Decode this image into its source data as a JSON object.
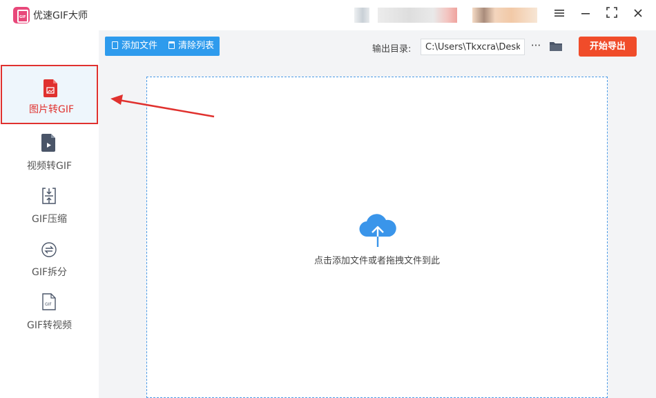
{
  "window": {
    "title": "优速GIF大师",
    "logo_text": "GIF",
    "controls": [
      "menu-icon",
      "minimize-icon",
      "maximize-icon",
      "close-icon"
    ]
  },
  "sidebar": {
    "items": [
      {
        "label": "图片转GIF",
        "icon": "image-file-icon",
        "active": true
      },
      {
        "label": "视频转GIF",
        "icon": "video-file-icon",
        "active": false
      },
      {
        "label": "GIF压缩",
        "icon": "compress-icon",
        "active": false
      },
      {
        "label": "GIF拆分",
        "icon": "split-icon",
        "active": false
      },
      {
        "label": "GIF转视频",
        "icon": "gif-file-icon",
        "active": false
      }
    ]
  },
  "toolbar": {
    "add_file_label": "添加文件",
    "clear_list_label": "清除列表",
    "output_dir_label": "输出目录:",
    "output_dir_value": "C:\\Users\\Tkxcra\\Desktop",
    "more_label": "···",
    "export_label": "开始导出"
  },
  "dropzone": {
    "hint": "点击添加文件或者拖拽文件到此",
    "icon": "cloud-upload-icon"
  },
  "colors": {
    "accent_blue": "#2e9bed",
    "export_red": "#f04c2a",
    "active_red": "#e0312e",
    "icon_slate": "#4a5568"
  }
}
